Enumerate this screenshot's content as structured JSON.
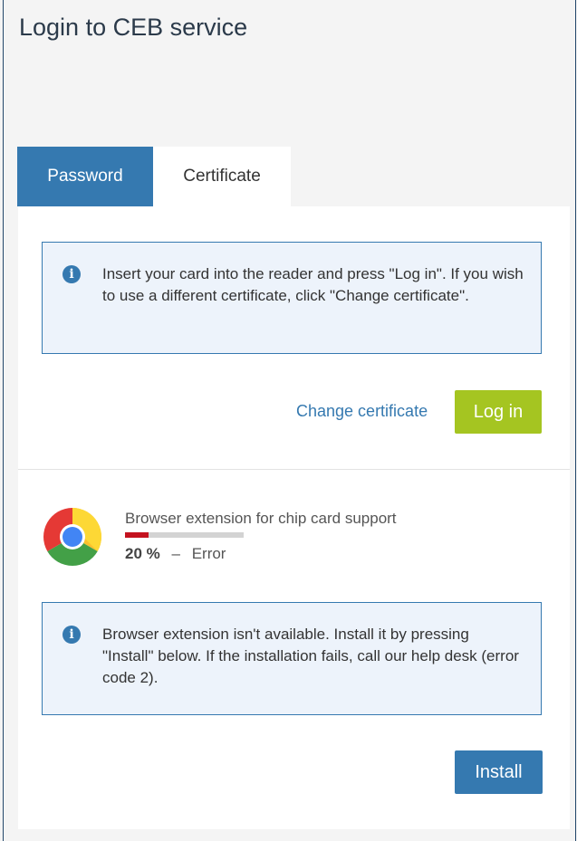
{
  "page": {
    "title": "Login to CEB service"
  },
  "tabs": [
    {
      "label": "Password",
      "active": false
    },
    {
      "label": "Certificate",
      "active": true
    }
  ],
  "certificate": {
    "info_text": "Insert your card into the reader and press \"Log in\". If you wish to use a different certificate, click \"Change certificate\".",
    "change_certificate_label": "Change certificate",
    "login_label": "Log in"
  },
  "extension": {
    "title": "Browser extension for chip card support",
    "progress_percent": 20,
    "progress_label": "20 %",
    "separator": "–",
    "status": "Error",
    "info_text": "Browser extension isn't available. Install it by pressing \"Install\" below. If the installation fails, call our help desk (error code 2).",
    "install_label": "Install"
  },
  "icons": {
    "info": "info-icon",
    "browser": "chrome-icon"
  },
  "colors": {
    "primary": "#3579b0",
    "login_green": "#a5c521",
    "error_red": "#c4121f",
    "info_bg": "#edf3fb"
  }
}
